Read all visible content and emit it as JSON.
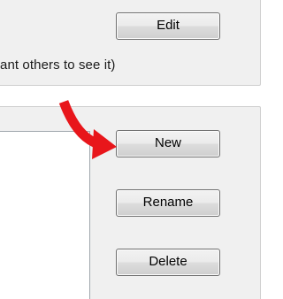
{
  "top_section": {
    "hint_text": "ant others to see it)",
    "edit_label": "Edit"
  },
  "bottom_section": {
    "buttons": {
      "new_label": "New",
      "rename_label": "Rename",
      "delete_label": "Delete"
    }
  },
  "annotation": {
    "arrow_color": "#e8161b",
    "arrow_target": "new-button",
    "icon": "curved-arrow-icon"
  }
}
